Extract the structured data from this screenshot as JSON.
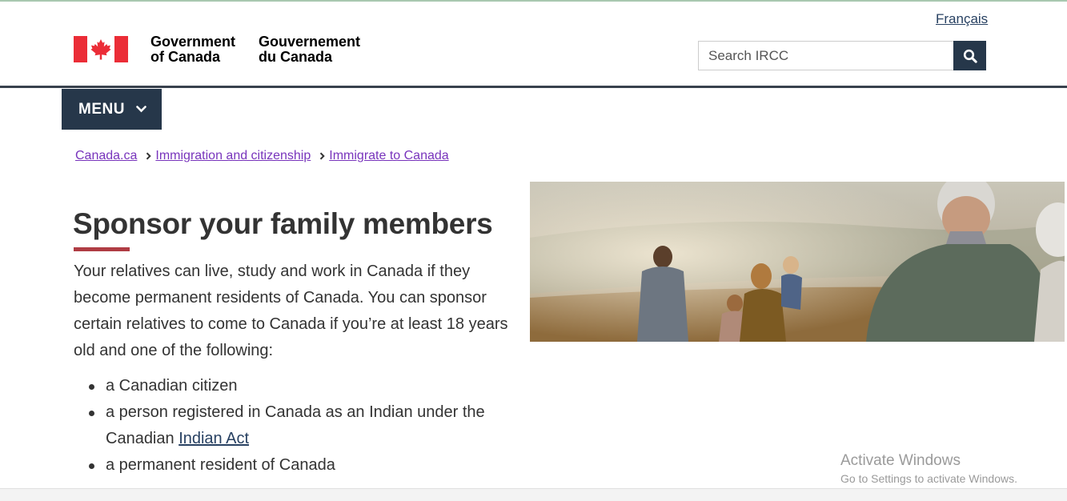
{
  "header": {
    "language_toggle": "Français",
    "wordmark_en_line1": "Government",
    "wordmark_en_line2": "of Canada",
    "wordmark_fr_line1": "Gouvernement",
    "wordmark_fr_line2": "du Canada",
    "search_placeholder": "Search IRCC",
    "search_icon": "search-icon"
  },
  "menu": {
    "label": "MENU",
    "icon": "chevron-down-icon"
  },
  "breadcrumb": [
    {
      "label": "Canada.ca"
    },
    {
      "label": "Immigration and citizenship"
    },
    {
      "label": "Immigrate to Canada"
    }
  ],
  "main": {
    "title": "Sponsor your family members",
    "intro": "Your relatives can live, study and work in Canada if they become permanent residents of Canada. You can sponsor certain relatives to come to Canada if you’re at least 18 years old and one of the following:",
    "list": {
      "item1": "a Canadian citizen",
      "item2_prefix": "a person registered in Canada as an Indian under the Canadian",
      "item2_link": "Indian Act",
      "item3": "a permanent resident of Canada"
    }
  },
  "watermark": {
    "line1": "Activate Windows",
    "line2": "Go to Settings to activate Windows."
  },
  "colors": {
    "nav_dark": "#26374a",
    "link_visited": "#7834bc",
    "link": "#284162",
    "title_accent": "#af3c43",
    "flag_red": "#eb2d37"
  }
}
